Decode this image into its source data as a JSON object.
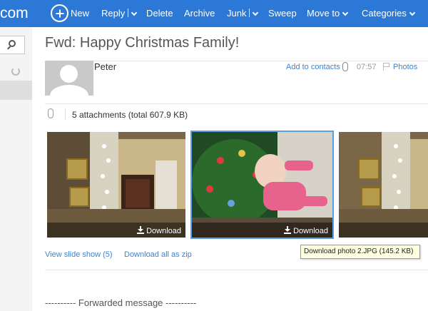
{
  "brand": {
    "partial_text": "com"
  },
  "toolbar": {
    "new_label": "New",
    "reply_label": "Reply",
    "delete_label": "Delete",
    "archive_label": "Archive",
    "junk_label": "Junk",
    "sweep_label": "Sweep",
    "move_to_label": "Move to",
    "categories_label": "Categories"
  },
  "message": {
    "subject": "Fwd: Happy Christmas Family!",
    "sender": "Peter",
    "add_contacts": "Add to contacts",
    "time": "07:57",
    "photos_link": "Photos",
    "attachments_summary": "5 attachments (total 607.9 KB)",
    "forwarded_label": "---------- Forwarded message ----------"
  },
  "attachments": {
    "download_label": "Download",
    "slideshow_link": "View slide show (5)",
    "download_zip_link": "Download all as zip",
    "tooltip": "Download photo 2.JPG (145.2 KB)"
  },
  "colors": {
    "topbar": "#2b78d6",
    "link": "#3a83d6",
    "selected_outline": "#5b9fe0"
  }
}
